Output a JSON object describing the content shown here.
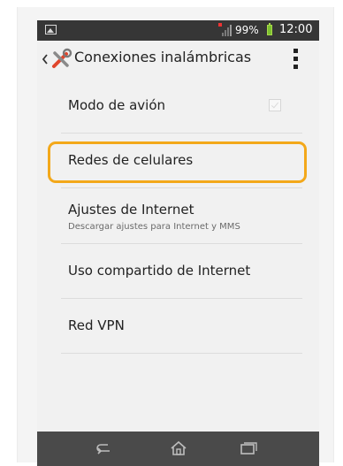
{
  "status_bar": {
    "battery_percent": "99%",
    "time": "12:00",
    "icons": [
      "picture-icon",
      "signal-icon",
      "battery-icon"
    ]
  },
  "action_bar": {
    "title": "Conexiones inalámbricas",
    "icons": [
      "back-icon",
      "tools-icon",
      "overflow-menu-icon"
    ]
  },
  "settings": {
    "items": [
      {
        "label": "Modo de avión",
        "checked": false
      },
      {
        "label": "Redes de celulares"
      },
      {
        "label": "Ajustes de Internet",
        "sub": "Descargar ajustes para Internet y MMS"
      },
      {
        "label": "Uso compartido de Internet"
      },
      {
        "label": "Red VPN"
      }
    ]
  },
  "highlight": {
    "color": "#f3a81a",
    "target": "Redes de celulares"
  },
  "nav_bar": {
    "icons": [
      "back-nav-icon",
      "home-nav-icon",
      "recents-nav-icon"
    ]
  },
  "colors": {
    "status_bar": "#363636",
    "background": "#f1f1f1",
    "nav_bar": "#4a4a4a",
    "battery": "#7cc12f"
  }
}
